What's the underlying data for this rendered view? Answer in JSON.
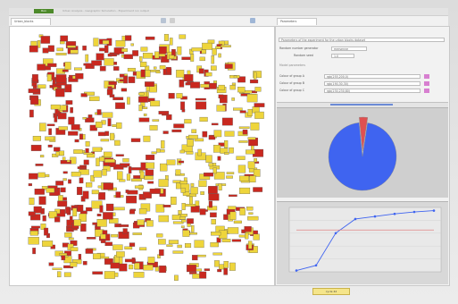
{
  "window": {
    "title": "Urban Analysis - Geographic Simulation - Experiment run output",
    "run_button": "Run"
  },
  "tabs": {
    "map_tab": "Urban_blocks",
    "results_tab": "Parameters"
  },
  "params": {
    "description": "Parameters of the experiment for the urban blocks dataset",
    "rows": [
      {
        "label": "Random number generator",
        "value": "mersenne"
      },
      {
        "label": "Random seed",
        "value": "1.0"
      },
      {
        "label": "Colour of group A",
        "value": "rgb(255,200,0)",
        "color": "#d77fd0"
      },
      {
        "label": "Colour of group B",
        "value": "rgb(190,30,30)",
        "color": "#d77fd0"
      },
      {
        "label": "Colour of group C",
        "value": "rgb(230,230,80)",
        "color": "#d77fd0"
      }
    ],
    "section_label": "Model parameters"
  },
  "pie_chart": {
    "chart_data": {
      "type": "pie",
      "slices": [
        {
          "value": 96,
          "color": "#3f64f0"
        },
        {
          "value": 4,
          "color": "#e05050"
        }
      ]
    }
  },
  "line_chart": {
    "chart_data": {
      "type": "line",
      "x": [
        0,
        1,
        2,
        3,
        4,
        5,
        6,
        7
      ],
      "series": [
        {
          "values": [
            0.02,
            0.1,
            0.6,
            0.82,
            0.86,
            0.9,
            0.93,
            0.95
          ],
          "color": "#3f64f0"
        },
        {
          "values": [
            0.65,
            0.65,
            0.65,
            0.65,
            0.65,
            0.65,
            0.65,
            0.65
          ],
          "color": "#e07070"
        }
      ],
      "ylim": [
        0,
        1
      ]
    }
  },
  "status": {
    "label": "cycle 42"
  },
  "colors": {
    "red_block": "#c9281f",
    "yellow_block": "#eed53b",
    "accent": "#4d8a2a"
  }
}
